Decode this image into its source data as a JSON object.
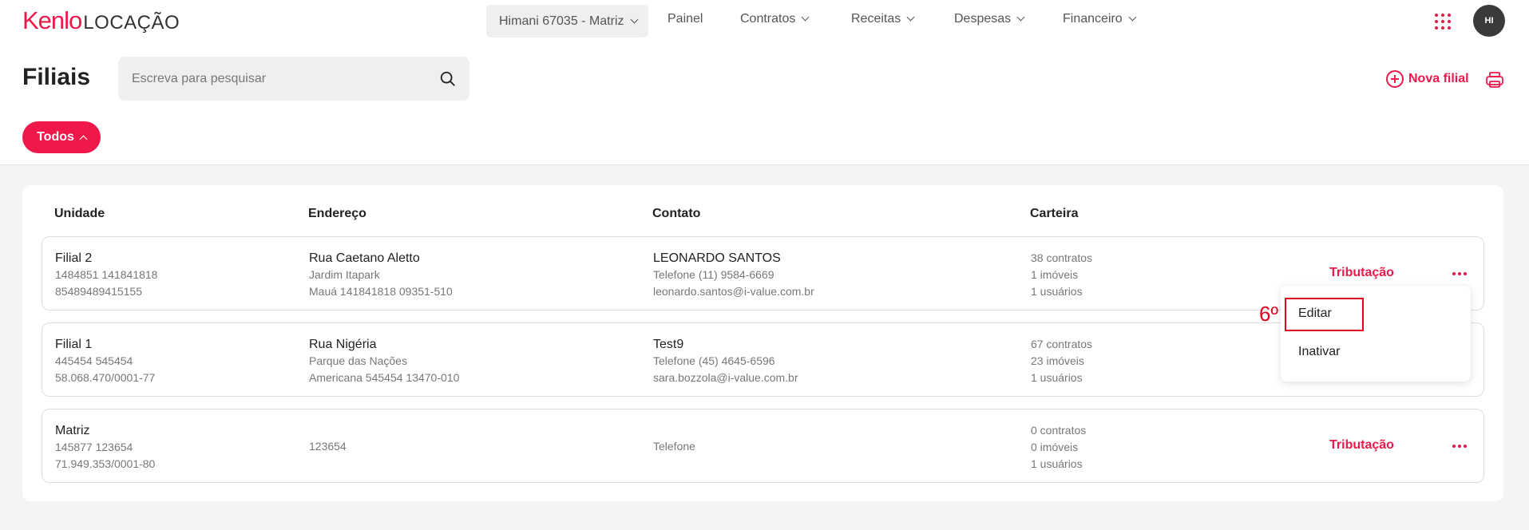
{
  "brand": {
    "name": "Kenlo",
    "product": "LOCAÇÃO",
    "accent": "#f0174a"
  },
  "topbar": {
    "tenant": "Himani 67035 - Matriz",
    "nav": [
      "Painel",
      "Contratos",
      "Receitas",
      "Despesas",
      "Financeiro"
    ],
    "avatar_initials": "HI"
  },
  "page": {
    "title": "Filiais",
    "search_placeholder": "Escreva para pesquisar",
    "new_button": "Nova filial",
    "filter": "Todos"
  },
  "table": {
    "headers": [
      "Unidade",
      "Endereço",
      "Contato",
      "Carteira"
    ],
    "action_label": "Tributação",
    "rows": [
      {
        "unit": [
          "Filial 2",
          "1484851 141841818",
          "85489489415155"
        ],
        "address": [
          "Rua Caetano Aletto",
          "Jardim Itapark",
          "Mauá 141841818 09351-510"
        ],
        "contact": [
          "LEONARDO SANTOS",
          "Telefone (11) 9584-6669",
          "leonardo.santos@i-value.com.br"
        ],
        "portfolio": [
          "38 contratos",
          "1 imóveis",
          "1 usuários"
        ]
      },
      {
        "unit": [
          "Filial 1",
          "445454 545454",
          "58.068.470/0001-77"
        ],
        "address": [
          "Rua Nigéria",
          "Parque das Nações",
          "Americana 545454 13470-010"
        ],
        "contact": [
          "Test9",
          "Telefone (45) 4645-6596",
          "sara.bozzola@i-value.com.br"
        ],
        "portfolio": [
          "67 contratos",
          "23 imóveis",
          "1 usuários"
        ]
      },
      {
        "unit": [
          "Matriz",
          "145877 123654",
          "71.949.353/0001-80"
        ],
        "address": [
          "123654"
        ],
        "contact": [
          "Telefone"
        ],
        "portfolio": [
          "0 contratos",
          "0 imóveis",
          "1 usuários"
        ]
      }
    ]
  },
  "menu": {
    "items": [
      "Editar",
      "Inativar"
    ]
  },
  "annotation": {
    "step": "6º",
    "color": "#e3001b"
  }
}
